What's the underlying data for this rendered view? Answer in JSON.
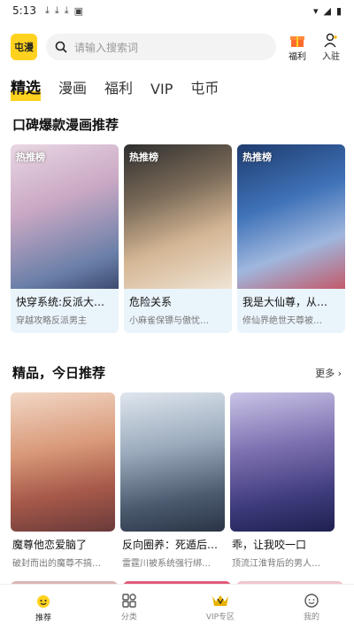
{
  "status": {
    "time": "5:13"
  },
  "header": {
    "logo_text": "屯漫",
    "search_placeholder": "请输入搜索词",
    "welfare_label": "福利",
    "join_label": "入驻"
  },
  "tabs": [
    "精选",
    "漫画",
    "福利",
    "VIP",
    "屯币"
  ],
  "section1": {
    "title": "口碑爆款漫画推荐",
    "cards": [
      {
        "badge": "热推榜",
        "title": "快穿系统:反派大…",
        "subtitle": "穿越攻略反派男主"
      },
      {
        "badge": "热推榜",
        "title": "危险关系",
        "subtitle": "小麻雀保镖与傲忧…"
      },
      {
        "badge": "热推榜",
        "title": "我是大仙尊，从…",
        "subtitle": "修仙界绝世天尊被…"
      }
    ]
  },
  "section2": {
    "title": "精品，今日推荐",
    "more": "更多",
    "cards": [
      {
        "title": "魔尊他恋爱脑了",
        "subtitle": "破封而出的魔尊不搞…"
      },
      {
        "title": "反向圈养：死遁后我…",
        "subtitle": "雷霆川被系统强行绑…"
      },
      {
        "title": "乖，让我咬一口",
        "subtitle": "顶流江淮背后的男人…"
      }
    ]
  },
  "nav": [
    "推荐",
    "分类",
    "VIP专区",
    "我的"
  ],
  "colors": {
    "accent": "#ffd21f"
  }
}
